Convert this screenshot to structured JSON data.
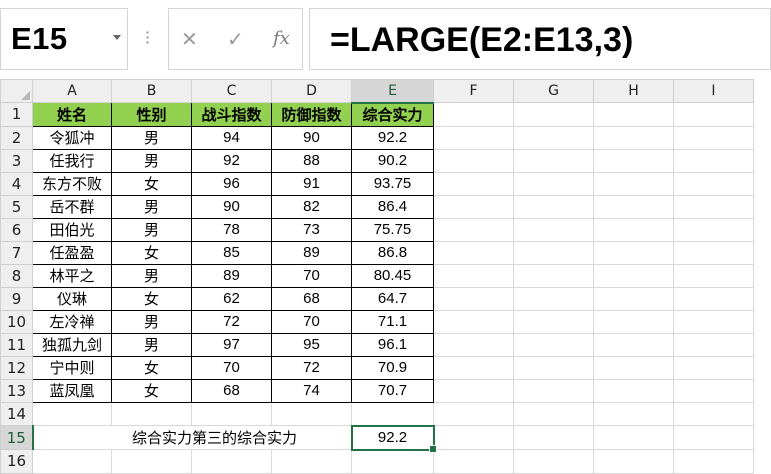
{
  "name_box": {
    "value": "E15"
  },
  "formula_bar": {
    "cancel_icon": "✕",
    "enter_icon": "✓",
    "fx_label": "fx",
    "formula": "=LARGE(E2:E13,3)"
  },
  "columns": [
    "A",
    "B",
    "C",
    "D",
    "E",
    "F",
    "G",
    "H",
    "I"
  ],
  "rows": [
    "1",
    "2",
    "3",
    "4",
    "5",
    "6",
    "7",
    "8",
    "9",
    "10",
    "11",
    "12",
    "13",
    "14",
    "15",
    "16"
  ],
  "header": [
    "姓名",
    "性别",
    "战斗指数",
    "防御指数",
    "综合实力"
  ],
  "data": [
    [
      "令狐冲",
      "男",
      "94",
      "90",
      "92.2"
    ],
    [
      "任我行",
      "男",
      "92",
      "88",
      "90.2"
    ],
    [
      "东方不败",
      "女",
      "96",
      "91",
      "93.75"
    ],
    [
      "岳不群",
      "男",
      "90",
      "82",
      "86.4"
    ],
    [
      "田伯光",
      "男",
      "78",
      "73",
      "75.75"
    ],
    [
      "任盈盈",
      "女",
      "85",
      "89",
      "86.8"
    ],
    [
      "林平之",
      "男",
      "89",
      "70",
      "80.45"
    ],
    [
      "仪琳",
      "女",
      "62",
      "68",
      "64.7"
    ],
    [
      "左冷禅",
      "男",
      "72",
      "70",
      "71.1"
    ],
    [
      "独孤九剑",
      "男",
      "97",
      "95",
      "96.1"
    ],
    [
      "宁中则",
      "女",
      "70",
      "72",
      "70.9"
    ],
    [
      "蓝凤凰",
      "女",
      "68",
      "74",
      "70.7"
    ]
  ],
  "row15": {
    "label": "综合实力第三的综合实力",
    "result": "92.2"
  },
  "colors": {
    "header_fill": "#92d050",
    "selection": "#217346"
  }
}
